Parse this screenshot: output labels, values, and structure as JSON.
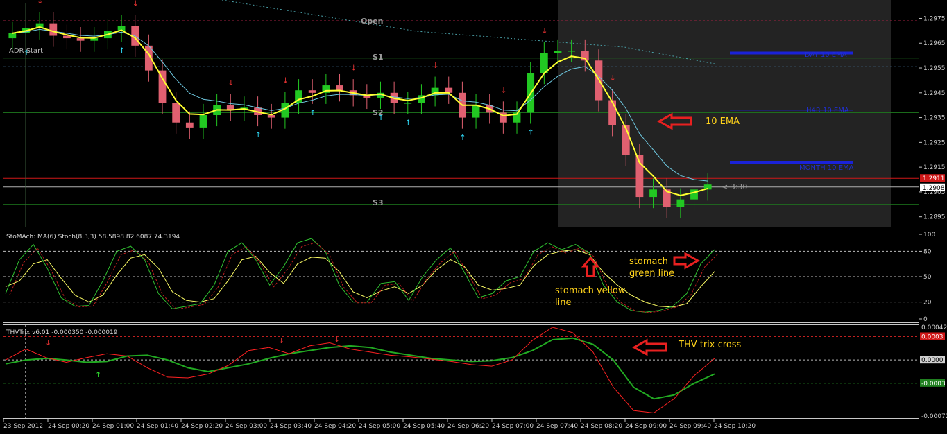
{
  "chart_data": [
    {
      "type": "candlestick",
      "ylim": [
        1.2891,
        1.2981
      ],
      "y_ticks": [
        "1.2975",
        "1.2965",
        "1.2955",
        "1.2945",
        "1.2935",
        "1.2925",
        "1.2915",
        "1.2905",
        "1.2895"
      ],
      "last_price": "1.2908",
      "top_price_tag": "1.2911",
      "countdown": "< 3:30",
      "levels": {
        "open": {
          "label": "Open",
          "value": 1.2974
        },
        "s1": {
          "label": "S1",
          "value": 1.2959
        },
        "pivot_dotted": {
          "value": 1.29555
        },
        "s2": {
          "label": "S2",
          "value": 1.2937
        },
        "red_line": {
          "value": 1.29105
        },
        "s3": {
          "label": "S3",
          "value": 1.29
        }
      },
      "adr_label": "ADR Start",
      "ema_labels": [
        {
          "text": "DAY 10 EMA",
          "value": 1.2961
        },
        {
          "text": "H4R 10 EMA",
          "value": 1.2938
        },
        {
          "text": "MONTH 10 EMA",
          "value": 1.2917
        }
      ],
      "annotation_ema": "10 EMA",
      "x_ticks": [
        "23 Sep 2012",
        "24 Sep 00:20",
        "24 Sep 01:00",
        "24 Sep 01:40",
        "24 Sep 02:20",
        "24 Sep 03:00",
        "24 Sep 03:40",
        "24 Sep 04:20",
        "24 Sep 05:00",
        "24 Sep 05:40",
        "24 Sep 06:20",
        "24 Sep 07:00",
        "24 Sep 07:40",
        "24 Sep 08:20",
        "24 Sep 09:00",
        "24 Sep 09:40",
        "24 Sep 10:20"
      ],
      "close_series": [
        1.2969,
        1.2971,
        1.2973,
        1.2968,
        1.2967,
        1.2966,
        1.2967,
        1.297,
        1.2972,
        1.2964,
        1.2954,
        1.2941,
        1.2933,
        1.2931,
        1.2936,
        1.294,
        1.2938,
        1.2939,
        1.2936,
        1.2935,
        1.2941,
        1.2946,
        1.2945,
        1.2948,
        1.2946,
        1.2944,
        1.2943,
        1.2945,
        1.2941,
        1.2941,
        1.2944,
        1.2947,
        1.2945,
        1.2935,
        1.294,
        1.2937,
        1.2933,
        1.2937,
        1.2953,
        1.2961,
        1.2962,
        1.2962,
        1.2958,
        1.2942,
        1.2932,
        1.292,
        1.2903,
        1.2906,
        1.2899,
        1.2902,
        1.2906,
        1.2908
      ]
    },
    {
      "type": "line",
      "title": "StoMAch: MA(6)  Stoch(8,3,3) 58.5898 82.6087 74.3194",
      "ylim": [
        0,
        100
      ],
      "y_ticks": [
        "100",
        "80",
        "50",
        "20",
        "0"
      ],
      "levels": [
        80,
        50,
        20
      ],
      "series": [
        {
          "color": "#ffff66",
          "values": [
            38,
            45,
            65,
            70,
            48,
            28,
            20,
            28,
            52,
            72,
            76,
            60,
            32,
            22,
            20,
            24,
            45,
            70,
            74,
            55,
            42,
            65,
            73,
            72,
            56,
            32,
            25,
            33,
            38,
            30,
            40,
            58,
            70,
            62,
            40,
            34,
            36,
            40,
            63,
            76,
            80,
            82,
            76,
            55,
            40,
            28,
            20,
            15,
            14,
            18,
            38,
            56
          ]
        },
        {
          "color": "#30c030",
          "values": [
            30,
            70,
            88,
            60,
            25,
            15,
            16,
            45,
            80,
            86,
            70,
            30,
            12,
            15,
            18,
            40,
            80,
            90,
            70,
            40,
            62,
            90,
            95,
            80,
            40,
            20,
            20,
            42,
            44,
            22,
            50,
            70,
            84,
            55,
            25,
            30,
            45,
            50,
            80,
            90,
            82,
            88,
            78,
            40,
            20,
            10,
            8,
            10,
            15,
            30,
            65,
            82
          ]
        }
      ],
      "annotations": [
        "stomach yellow line",
        "stomach green line"
      ]
    },
    {
      "type": "line",
      "title": "THVTrix v6.01 -0.000350 -0.000019",
      "ylim": [
        -0.00072,
        0.00042
      ],
      "y_ticks": [
        "0.00042",
        "0.0003",
        "0.0000",
        "-0.0003",
        "-0.00072"
      ],
      "levels": [
        0.0003,
        0.0,
        -0.0003
      ],
      "series": [
        {
          "color": "#22aa22",
          "values": [
            -5e-05,
            0.0,
            2e-05,
            0.0,
            -3e-05,
            -2e-05,
            5e-05,
            6e-05,
            0.0,
            -0.0001,
            -0.00015,
            -0.0001,
            -5e-05,
            2e-05,
            8e-05,
            0.00012,
            0.00016,
            0.00018,
            0.00016,
            0.0001,
            6e-05,
            2e-05,
            0.0,
            -2e-05,
            -1e-05,
            3e-05,
            0.00012,
            0.00026,
            0.00028,
            0.0002,
            0.0,
            -0.00035,
            -0.0005,
            -0.00045,
            -0.0003,
            -0.00018
          ]
        },
        {
          "color": "#ff2222",
          "values": [
            0.0,
            0.00014,
            3e-05,
            -3e-05,
            3e-05,
            8e-05,
            5e-05,
            -0.0001,
            -0.00022,
            -0.00023,
            -0.00018,
            -7e-05,
            0.00012,
            0.00016,
            8e-05,
            0.00018,
            0.00022,
            0.00014,
            0.0001,
            6e-05,
            4e-05,
            1e-05,
            -2e-05,
            -6e-05,
            -8e-05,
            0.0,
            0.00025,
            0.00042,
            0.00035,
            0.0001,
            -0.00035,
            -0.00065,
            -0.00068,
            -0.0005,
            -0.0002,
            2e-05
          ]
        }
      ],
      "annotation": "THV trix cross"
    }
  ]
}
